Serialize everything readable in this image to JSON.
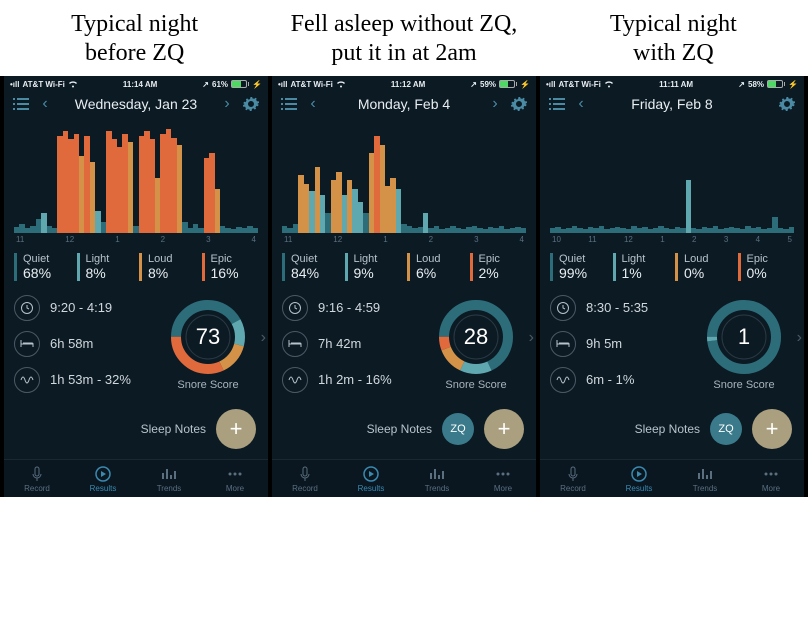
{
  "captions": [
    "Typical night\nbefore ZQ",
    "Fell asleep without ZQ,\nput it in at 2am",
    "Typical night\nwith ZQ"
  ],
  "phones": [
    {
      "status": {
        "carrier": "AT&T Wi-Fi",
        "time": "11:14 AM",
        "battery_pct": "61%",
        "battery_fill": 61
      },
      "nav": {
        "title": "Wednesday, Jan 23",
        "show_next": true
      },
      "axis": [
        "11",
        "12",
        "1",
        "2",
        "3",
        "4"
      ],
      "legend": {
        "quiet": "68%",
        "light": "8%",
        "loud": "8%",
        "epic": "16%"
      },
      "labels": {
        "quiet": "Quiet",
        "light": "Light",
        "loud": "Loud",
        "epic": "Epic"
      },
      "time_range": "9:20 - 4:19",
      "duration": "6h 58m",
      "snore": "1h 53m - 32%",
      "score": 73,
      "score_label": "Snore Score",
      "notes": "Sleep Notes",
      "show_zq": false,
      "ring": {
        "quiet": 42,
        "light": 12,
        "loud": 14,
        "epic": 32
      },
      "bars": [
        5,
        8,
        4,
        6,
        12,
        18,
        6,
        4,
        88,
        92,
        85,
        90,
        70,
        88,
        64,
        20,
        10,
        92,
        85,
        78,
        90,
        82,
        6,
        88,
        92,
        85,
        50,
        90,
        94,
        86,
        80,
        10,
        4,
        8,
        4,
        68,
        72,
        40,
        6,
        4,
        3,
        5,
        4,
        6,
        4
      ],
      "bar_types": [
        "q",
        "q",
        "q",
        "q",
        "q",
        "l",
        "q",
        "q",
        "e",
        "e",
        "e",
        "e",
        "o",
        "e",
        "o",
        "l",
        "q",
        "e",
        "e",
        "e",
        "e",
        "o",
        "q",
        "e",
        "e",
        "e",
        "o",
        "e",
        "e",
        "e",
        "o",
        "q",
        "q",
        "q",
        "q",
        "e",
        "e",
        "o",
        "q",
        "q",
        "q",
        "q",
        "q",
        "q",
        "q"
      ]
    },
    {
      "status": {
        "carrier": "AT&T Wi-Fi",
        "time": "11:12 AM",
        "battery_pct": "59%",
        "battery_fill": 59
      },
      "nav": {
        "title": "Monday, Feb 4",
        "show_next": true
      },
      "axis": [
        "11",
        "12",
        "1",
        "2",
        "3",
        "4"
      ],
      "legend": {
        "quiet": "84%",
        "light": "9%",
        "loud": "6%",
        "epic": "2%"
      },
      "labels": {
        "quiet": "Quiet",
        "light": "Light",
        "loud": "Loud",
        "epic": "Epic"
      },
      "time_range": "9:16 - 4:59",
      "duration": "7h 42m",
      "snore": "1h 2m - 16%",
      "score": 28,
      "score_label": "Snore Score",
      "notes": "Sleep Notes",
      "show_zq": true,
      "ring": {
        "quiet": 68,
        "light": 14,
        "loud": 12,
        "epic": 6
      },
      "bars": [
        6,
        4,
        8,
        52,
        44,
        38,
        60,
        34,
        18,
        48,
        55,
        34,
        48,
        40,
        28,
        18,
        72,
        88,
        80,
        42,
        50,
        40,
        8,
        6,
        4,
        5,
        18,
        4,
        6,
        3,
        4,
        6,
        4,
        3,
        5,
        6,
        4,
        3,
        5,
        4,
        6,
        3,
        4,
        5,
        4
      ],
      "bar_types": [
        "q",
        "q",
        "q",
        "o",
        "o",
        "l",
        "o",
        "l",
        "q",
        "o",
        "o",
        "l",
        "o",
        "l",
        "l",
        "q",
        "o",
        "e",
        "o",
        "o",
        "o",
        "l",
        "q",
        "q",
        "q",
        "q",
        "l",
        "q",
        "q",
        "q",
        "q",
        "q",
        "q",
        "q",
        "q",
        "q",
        "q",
        "q",
        "q",
        "q",
        "q",
        "q",
        "q",
        "q",
        "q"
      ]
    },
    {
      "status": {
        "carrier": "AT&T Wi-Fi",
        "time": "11:11 AM",
        "battery_pct": "58%",
        "battery_fill": 58
      },
      "nav": {
        "title": "Friday, Feb 8",
        "show_next": false
      },
      "axis": [
        "10",
        "11",
        "12",
        "1",
        "2",
        "3",
        "4",
        "5"
      ],
      "legend": {
        "quiet": "99%",
        "light": "1%",
        "loud": "0%",
        "epic": "0%"
      },
      "labels": {
        "quiet": "Quiet",
        "light": "Light",
        "loud": "Loud",
        "epic": "Epic"
      },
      "time_range": "8:30 - 5:35",
      "duration": "9h 5m",
      "snore": "6m - 1%",
      "score": 1,
      "score_label": "Snore Score",
      "notes": "Sleep Notes",
      "show_zq": true,
      "ring": {
        "quiet": 98,
        "light": 2,
        "loud": 0,
        "epic": 0
      },
      "bars": [
        4,
        5,
        3,
        4,
        6,
        4,
        3,
        5,
        4,
        6,
        3,
        4,
        5,
        4,
        3,
        6,
        4,
        5,
        3,
        4,
        6,
        4,
        3,
        5,
        4,
        48,
        4,
        3,
        5,
        4,
        6,
        3,
        4,
        5,
        4,
        3,
        6,
        4,
        5,
        3,
        4,
        14,
        4,
        3,
        5
      ],
      "bar_types": [
        "q",
        "q",
        "q",
        "q",
        "q",
        "q",
        "q",
        "q",
        "q",
        "q",
        "q",
        "q",
        "q",
        "q",
        "q",
        "q",
        "q",
        "q",
        "q",
        "q",
        "q",
        "q",
        "q",
        "q",
        "q",
        "l",
        "q",
        "q",
        "q",
        "q",
        "q",
        "q",
        "q",
        "q",
        "q",
        "q",
        "q",
        "q",
        "q",
        "q",
        "q",
        "q",
        "q",
        "q",
        "q"
      ]
    }
  ],
  "tabs": {
    "record": "Record",
    "results": "Results",
    "trends": "Trends",
    "more": "More"
  }
}
